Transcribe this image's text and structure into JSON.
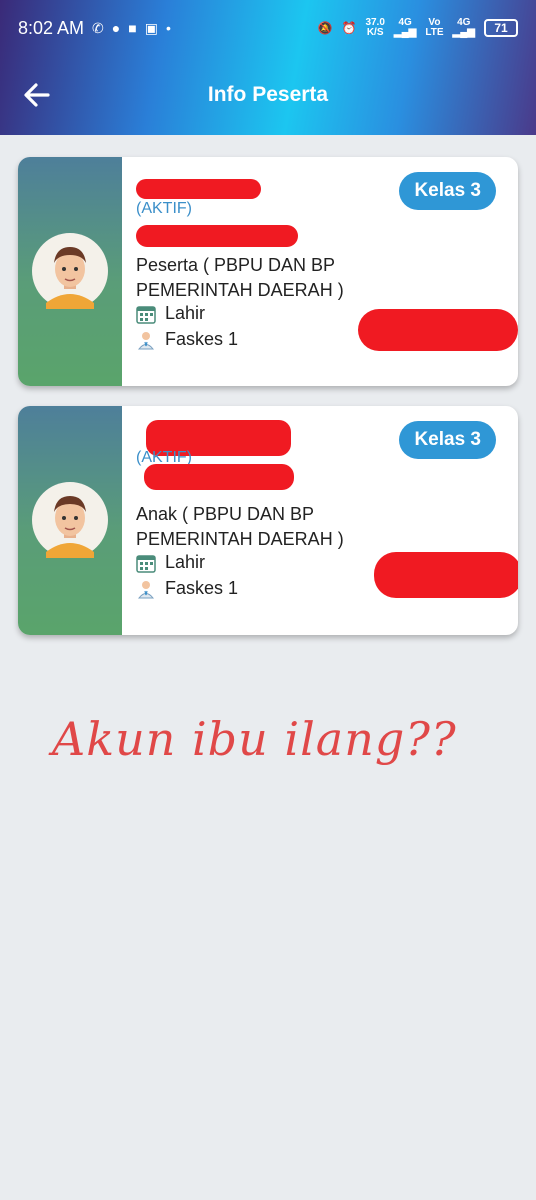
{
  "status_bar": {
    "time": "8:02 AM",
    "speed_value": "37.0",
    "speed_unit": "K/S",
    "net1": "4G",
    "volte_top": "Vo",
    "volte_bottom": "LTE",
    "net2": "4G",
    "battery": "71"
  },
  "header": {
    "title": "Info Peserta"
  },
  "cards": [
    {
      "status": "(AKTIF)",
      "class_badge": "Kelas 3",
      "type": "Peserta   ( PBPU DAN BP PEMERINTAH DAERAH )",
      "birth_label": "Lahir",
      "faskes_label": "Faskes 1"
    },
    {
      "status": "(AKTIF)",
      "class_badge": "Kelas 3",
      "type": "Anak   ( PBPU DAN BP PEMERINTAH DAERAH )",
      "birth_label": "Lahir",
      "faskes_label": "Faskes 1"
    }
  ],
  "annotation": "Akun ibu ilang??",
  "colors": {
    "accent": "#2f97d6",
    "aktif": "#3b8fc9",
    "redaction": "#f01a22",
    "handwriting": "#e04848"
  }
}
